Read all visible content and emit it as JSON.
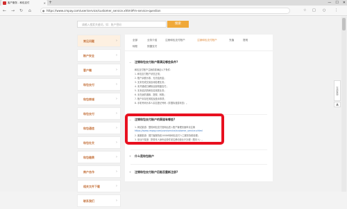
{
  "browser": {
    "tab_title": "客户服务 - 和包支付",
    "tab_close": "×",
    "new_tab": "+",
    "url": "https://www.cmpay.com/user/service/customer_service.xhtml#m-service-question",
    "controls": [
      "—",
      "☐",
      "✕"
    ]
  },
  "search": {
    "placeholder": "请输入搜索关键词，如：账户密码",
    "button": "搜索"
  },
  "sidebar": [
    {
      "label": "常见问题",
      "active": true
    },
    {
      "label": "账户安全",
      "active": false
    },
    {
      "label": "客户端",
      "active": false
    },
    {
      "label": "和包支付",
      "active": false
    },
    {
      "label": "和包商城",
      "active": false
    },
    {
      "label": "和包支付",
      "active": false
    },
    {
      "label": "和包通信",
      "active": false
    },
    {
      "label": "和包社交",
      "active": false
    },
    {
      "label": "和包缴费",
      "active": false
    },
    {
      "label": "商户合作",
      "active": false
    },
    {
      "label": "相关文件下载",
      "active": false
    },
    {
      "label": "联系我们",
      "active": false
    }
  ],
  "subnav": [
    "全部",
    "业务介绍",
    "注册和包支付账户",
    "注销和包支付账户",
    "充值",
    "提现",
    "转账",
    "快捷支付"
  ],
  "faqs": [
    {
      "title": "注销和包支付账户需满足哪些条件?",
      "toggle": "−",
      "lines": [
        "和包支付账户注销前需满足以下条件：",
        "1. 和包支付账户状态正常；",
        "2. 账户余额为零，无冻结资金；",
        "3. 无未完成交易及待处理业务；",
        "4. 未开通或已解除全部快捷支付；",
        "5. 无未结清的和包信用类业务；",
        "6. 无在途的退款、提现、转账；",
        "7. 账户未存在风险及投诉事项；",
        "8. 手机号码为本人实名登记号码（非国际漫游状态）。"
      ]
    },
    {
      "title": "注销和包支付账户的渠道有哪些?",
      "toggle": "−",
      "lines": [
        "1. 网站渠道：登陆和包支付官网后进入账户管理页面申请注销",
        "   https://www.cmpay.com/user/service/customer_service.xhtml",
        "2. 客服渠道：拨打客服热线10086转和包支付人工服务协助处理；",
        "3. 营业厅渠道：携带本人身份证原件前往移动营业厅办理（限本人）。"
      ]
    },
    {
      "title": "什么是和包账户",
      "toggle": "+",
      "lines": []
    },
    {
      "title": "注销和包支付账户后能否重新注册?",
      "toggle": "+",
      "lines": []
    }
  ],
  "float_panel": "在线客服",
  "float_up": "▲",
  "colors": {
    "accent": "#f0a93a",
    "highlight": "#e8101f",
    "side_text": "#c5733d"
  }
}
